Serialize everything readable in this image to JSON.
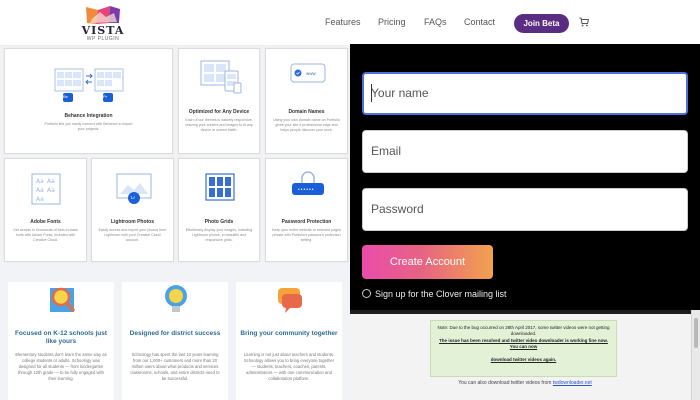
{
  "header": {
    "logo_title": "VISTA",
    "logo_sub": "WP PLUGIN",
    "nav": [
      "Features",
      "Pricing",
      "FAQs",
      "Contact"
    ],
    "cta": "Join Beta",
    "cart_icon": "cart-icon"
  },
  "features": {
    "cards": [
      {
        "title": "Behance Integration",
        "desc": "Portfolio lets you easily connect with Behance to import your projects."
      },
      {
        "title": "Optimized for Any Device",
        "desc": "Each of our themes is natively responsive, resizing your content and images to fit any device or screen width."
      },
      {
        "title": "Domain Names",
        "desc": "Using your own domain name on Portfolio gives your site a professional edge and helps people discover your work."
      },
      {
        "title": "Adobe Fonts",
        "desc": "Get access to thousands of best-in-class fonts with Adobe Fonts, included with Creative Cloud."
      },
      {
        "title": "Lightroom Photos",
        "desc": "Easily access and import your photos from Lightroom with your Creative Cloud account."
      },
      {
        "title": "Photo Grids",
        "desc": "Effortlessly display your images, including Lightroom photos, in beautiful and responsive grids."
      },
      {
        "title": "Password Protection",
        "desc": "Keep your entire website or selected pages private with Portfolio's password protection setting."
      }
    ],
    "illustration_labels": {
      "be": "Be",
      "pr": "Pr",
      "www": "www",
      "lr": "Lr",
      "password": "••••••"
    }
  },
  "info_cards": [
    {
      "title": "Focused on K-12 schools just like yours",
      "desc": "Elementary students don't learn the same way as college students or adults. Schoology was designed for all students — from kindergarten through 12th grade — to be fully engaged with their learning."
    },
    {
      "title": "Designed for district success",
      "desc": "Schoology has spent the last 10 years learning from our 1,000+ customers and more than 20 million users about what products and services classrooms, schools, and entire districts need to be successful."
    },
    {
      "title": "Bring your community together",
      "desc": "Learning is not just about teachers and students. Schoology allows you to bring everyone together — students, teachers, coaches, parents, administrators — with one communication and collaboration platform."
    }
  ],
  "signup": {
    "name_placeholder": "Your name",
    "email_placeholder": "Email",
    "password_placeholder": "Password",
    "create_label": "Create Account",
    "clover_label": "Sign up for the Clover mailing list"
  },
  "notice": {
    "line1": "Note: Due to the bug occurred on 28th April 2017, some twitter videos were not getting downloaded.",
    "line2": "The issue has been resolved and twitter video downloader is working fine now. You can now",
    "line3": "download twitter videos again.",
    "download_text": "You can also download twitter videos from",
    "download_link": "twdownloader.net"
  },
  "colors": {
    "accent": "#5b2d82",
    "title_blue": "#2b6c92",
    "link": "#2a55c9",
    "focus": "#4f6fdf"
  }
}
